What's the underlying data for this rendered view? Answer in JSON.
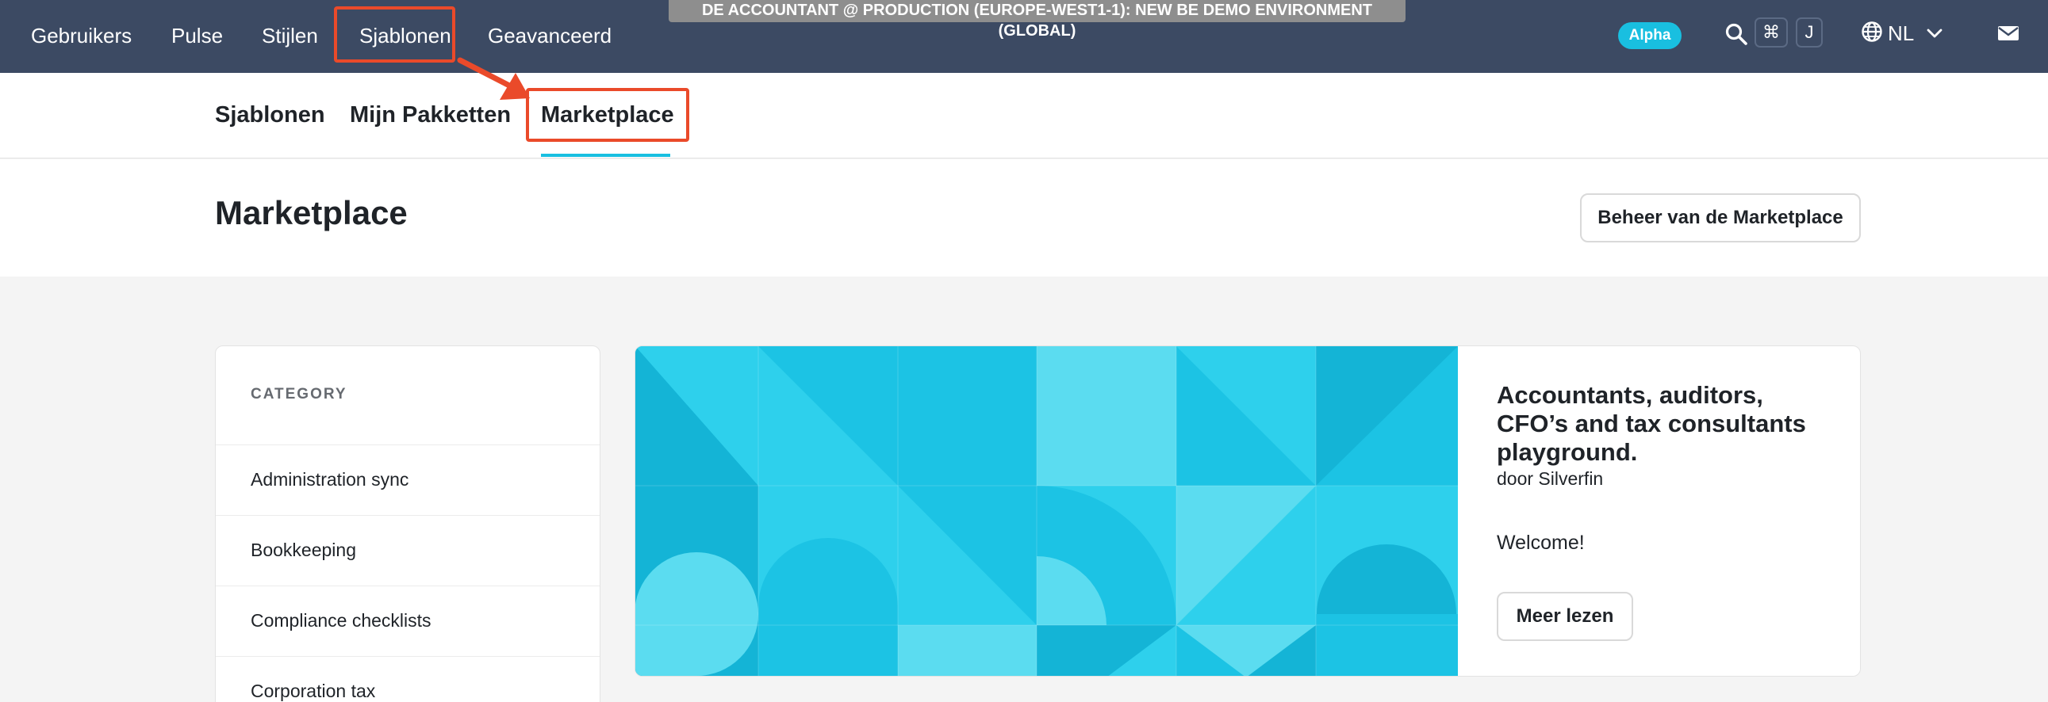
{
  "topnav": {
    "items": [
      "Gebruikers",
      "Pulse",
      "Stijlen",
      "Sjablonen",
      "Geavanceerd"
    ],
    "environment": "DE ACCOUNTANT @ PRODUCTION (EUROPE-WEST1-1): NEW BE DEMO ENVIRONMENT (GLOBAL)",
    "alpha_badge": "Alpha",
    "shortcut_keys": [
      "⌘",
      "J"
    ],
    "language": "NL"
  },
  "subnav": {
    "items": [
      "Sjablonen",
      "Mijn Pakketten",
      "Marketplace"
    ],
    "active": "Marketplace"
  },
  "header": {
    "title": "Marketplace",
    "admin_button": "Beheer van de Marketplace"
  },
  "sidebar": {
    "heading": "CATEGORY",
    "items": [
      "Administration sync",
      "Bookkeeping",
      "Compliance checklists",
      "Corporation tax"
    ]
  },
  "feature": {
    "title": "Accountants, auditors, CFO’s and tax consultants playground.",
    "author": "door Silverfin",
    "description": "Welcome!",
    "button": "Meer lezen"
  },
  "colors": {
    "nav_bg": "#3c4a63",
    "accent": "#19bfe0",
    "highlight": "#ea4a2a"
  }
}
